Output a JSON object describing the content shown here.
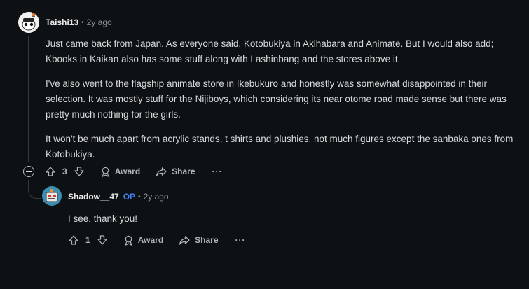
{
  "comment": {
    "username": "Taishi13",
    "time": "2y ago",
    "paragraphs": [
      "Just came back from Japan. As everyone said, Kotobukiya in Akihabara and Animate. But I would also add; Kbooks in Kaikan also has some stuff along with Lashinbang and the stores above it.",
      "I've also went to the flagship animate store in Ikebukuro and honestly was somewhat disappointed in their selection. It was mostly stuff for the Nijiboys, which considering its near otome road made sense but there was pretty much nothing for the girls.",
      "It won't be much apart from acrylic stands, t shirts and plushies, not much figures except the sanbaka ones from Kotobukiya."
    ],
    "votes": "3",
    "award_label": "Award",
    "share_label": "Share",
    "more_label": "···"
  },
  "reply": {
    "username": "Shadow__47",
    "op_badge": "OP",
    "time": "2y ago",
    "text": "I see, thank you!",
    "votes": "1",
    "award_label": "Award",
    "share_label": "Share",
    "more_label": "···"
  },
  "separator": "•",
  "colors": {
    "background": "#0e1113",
    "text": "#d7dadc",
    "muted": "#8b9297",
    "op": "#3d83f6"
  },
  "icons": [
    "upvote-icon",
    "downvote-icon",
    "award-icon",
    "share-icon",
    "more-icon",
    "collapse-icon"
  ]
}
